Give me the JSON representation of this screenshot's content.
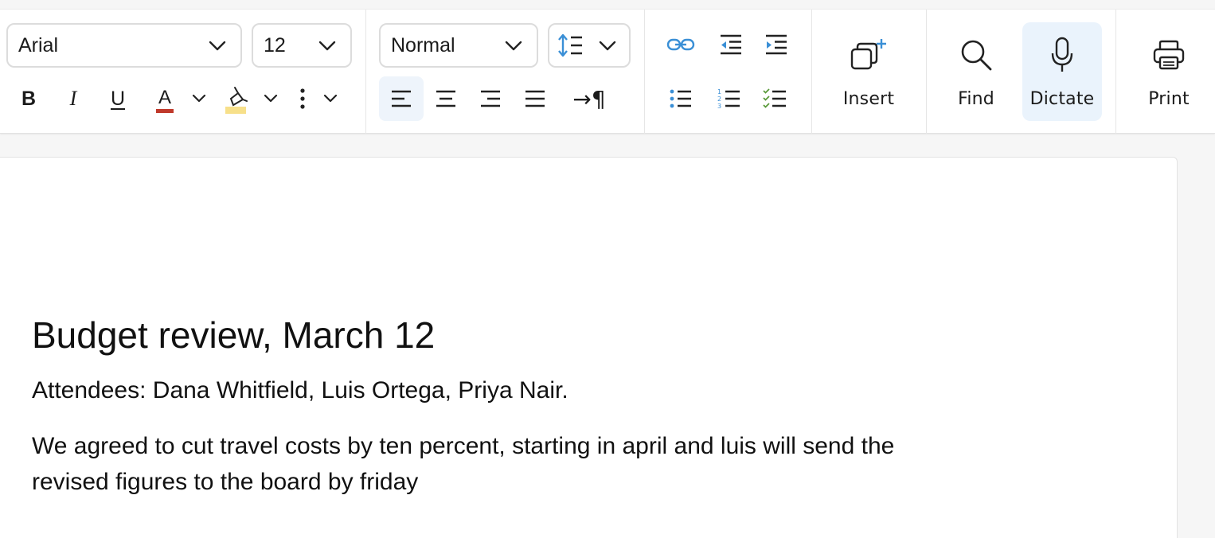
{
  "toolbar": {
    "font_family": "Arial",
    "font_size": "12",
    "paragraph_style": "Normal",
    "bold_glyph": "B",
    "italic_glyph": "I",
    "underline_glyph": "U",
    "font_color_glyph": "A",
    "line_spacing_icon": "line-spacing-icon",
    "ltr_glyph": "→¶",
    "insert_label": "Insert",
    "find_label": "Find",
    "dictate_label": "Dictate",
    "print_label": "Print",
    "active_alignment": "left",
    "dictate_active": true,
    "colors": {
      "accent": "#3a8fd6",
      "font_color_bar": "#c0392b",
      "highlight_bar": "#f7e08a",
      "active_bg": "#eaf3fc"
    }
  },
  "document": {
    "title": "Budget review, March 12",
    "attendees": "Attendees: Dana Whitfield, Luis Ortega, Priya Nair.",
    "body": "We agreed to cut travel costs by ten percent, starting in april and luis will send the revised figures to the board by friday"
  }
}
